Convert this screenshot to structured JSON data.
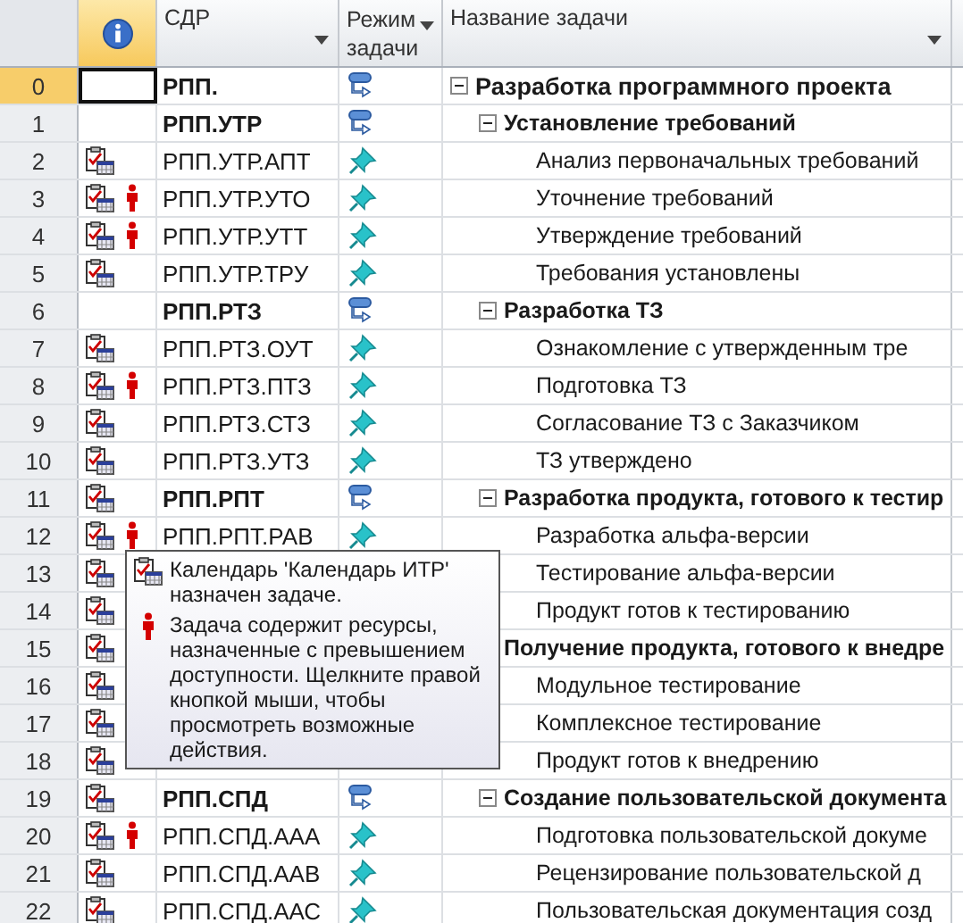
{
  "columns": [
    {
      "kind": "number"
    },
    {
      "kind": "info"
    },
    {
      "kind": "wbs",
      "label": "СДР"
    },
    {
      "kind": "mode",
      "label": "Режим задачи"
    },
    {
      "kind": "name",
      "label": "Название задачи"
    }
  ],
  "tasks": [
    {
      "num": "0",
      "wbs": "РПП.",
      "manually_scheduled": false,
      "name": "Разработка программного проекта",
      "calendar": false,
      "overallocated": false,
      "selected": true,
      "expanded": true,
      "children": [
        {
          "num": "1",
          "wbs": "РПП.УТР",
          "manually_scheduled": false,
          "name": "Установление требований",
          "calendar": false,
          "overallocated": false,
          "selected": false,
          "expanded": true,
          "children": [
            {
              "num": "2",
              "wbs": "РПП.УТР.АПТ",
              "manually_scheduled": true,
              "name": "Анализ первоначальных требований",
              "calendar": true,
              "overallocated": false,
              "selected": false
            },
            {
              "num": "3",
              "wbs": "РПП.УТР.УТО",
              "manually_scheduled": true,
              "name": "Уточнение требований",
              "calendar": true,
              "overallocated": true,
              "selected": false
            },
            {
              "num": "4",
              "wbs": "РПП.УТР.УТТ",
              "manually_scheduled": true,
              "name": "Утверждение требований",
              "calendar": true,
              "overallocated": true,
              "selected": false
            },
            {
              "num": "5",
              "wbs": "РПП.УТР.ТРУ",
              "manually_scheduled": true,
              "name": "Требования установлены",
              "calendar": true,
              "overallocated": false,
              "selected": false
            }
          ]
        },
        {
          "num": "6",
          "wbs": "РПП.РТЗ",
          "manually_scheduled": false,
          "name": "Разработка ТЗ",
          "calendar": false,
          "overallocated": false,
          "selected": false,
          "expanded": true,
          "children": [
            {
              "num": "7",
              "wbs": "РПП.РТЗ.ОУТ",
              "manually_scheduled": true,
              "name": "Ознакомление с утвержденным тре",
              "calendar": true,
              "overallocated": false,
              "selected": false
            },
            {
              "num": "8",
              "wbs": "РПП.РТЗ.ПТЗ",
              "manually_scheduled": true,
              "name": "Подготовка ТЗ",
              "calendar": true,
              "overallocated": true,
              "selected": false
            },
            {
              "num": "9",
              "wbs": "РПП.РТЗ.СТЗ",
              "manually_scheduled": true,
              "name": "Согласование ТЗ с Заказчиком",
              "calendar": true,
              "overallocated": false,
              "selected": false
            },
            {
              "num": "10",
              "wbs": "РПП.РТЗ.УТЗ",
              "manually_scheduled": true,
              "name": "ТЗ утверждено",
              "calendar": true,
              "overallocated": false,
              "selected": false
            }
          ]
        },
        {
          "num": "11",
          "wbs": "РПП.РПТ",
          "manually_scheduled": false,
          "name": "Разработка продукта, готового к тестир",
          "calendar": true,
          "overallocated": false,
          "selected": false,
          "expanded": true,
          "children": [
            {
              "num": "12",
              "wbs": "РПП.РПТ.РАВ",
              "manually_scheduled": true,
              "name": "Разработка альфа-версии",
              "calendar": true,
              "overallocated": true,
              "selected": false
            },
            {
              "num": "13",
              "name": "Тестирование альфа-версии",
              "calendar": true,
              "selected": false
            },
            {
              "num": "14",
              "name": "Продукт готов к тестированию",
              "calendar": true,
              "selected": false
            }
          ]
        },
        {
          "num": "15",
          "name": "Получение продукта, готового к внедре",
          "calendar": true,
          "selected": false,
          "children": [
            {
              "num": "16",
              "name": "Модульное тестирование",
              "calendar": true,
              "selected": false
            },
            {
              "num": "17",
              "name": "Комплексное тестирование",
              "calendar": true,
              "selected": false
            },
            {
              "num": "18",
              "name": "Продукт готов к внедрению",
              "calendar": true,
              "selected": false
            }
          ]
        },
        {
          "num": "19",
          "wbs": "РПП.СПД",
          "manually_scheduled": false,
          "name": "Создание пользовательской документа",
          "calendar": true,
          "overallocated": false,
          "selected": false,
          "expanded": true,
          "children": [
            {
              "num": "20",
              "wbs": "РПП.СПД.ААА",
              "manually_scheduled": true,
              "name": "Подготовка пользовательской докуме",
              "calendar": true,
              "overallocated": true,
              "selected": false
            },
            {
              "num": "21",
              "wbs": "РПП.СПД.ААВ",
              "manually_scheduled": true,
              "name": "Рецензирование пользовательской д",
              "calendar": true,
              "overallocated": false,
              "selected": false
            },
            {
              "num": "22",
              "wbs": "РПП.СПД.ААС",
              "manually_scheduled": true,
              "name": "Пользовательская документация созд",
              "calendar": true,
              "overallocated": false,
              "selected": false
            }
          ]
        }
      ]
    }
  ],
  "tooltip": {
    "entries": [
      {
        "kind": "calendar",
        "text": "Календарь 'Календарь ИТР' назначен задаче."
      },
      {
        "kind": "overallocation",
        "text": "Задача содержит ресурсы, назначенные с превышением доступности. Щелкните правой кнопкой мыши, чтобы просмотреть возможные действия."
      }
    ]
  }
}
